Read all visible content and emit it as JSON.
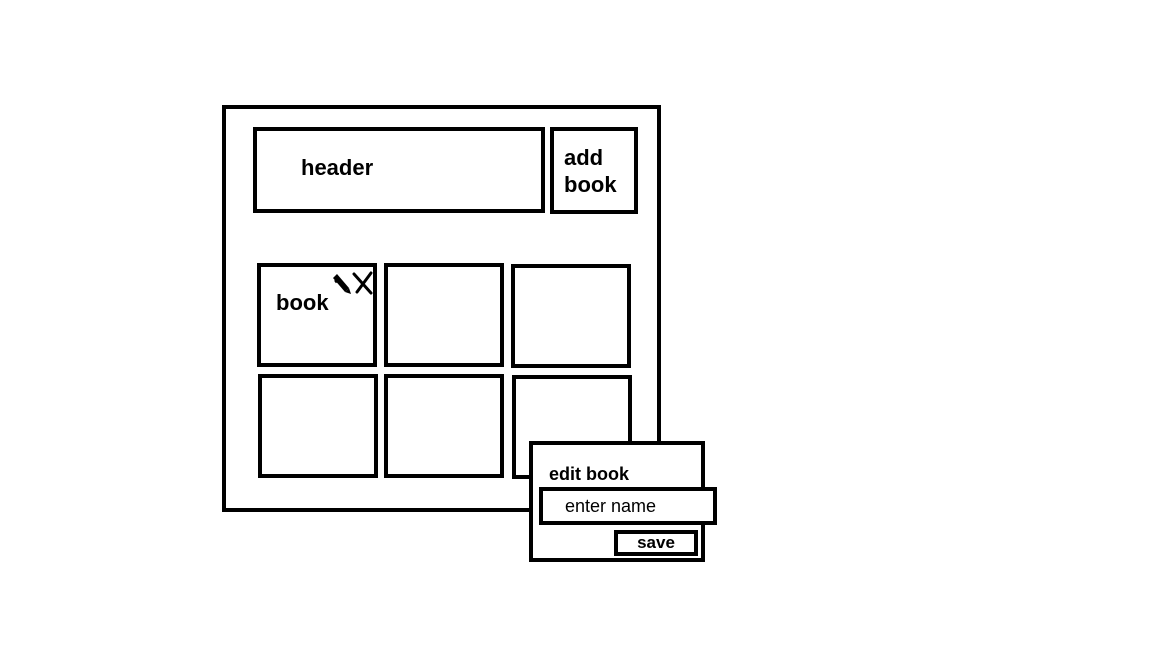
{
  "header": {
    "title": "header"
  },
  "toolbar": {
    "add_book_label": "add book"
  },
  "books": [
    {
      "label": "book",
      "has_actions": true
    },
    {
      "label": ""
    },
    {
      "label": ""
    },
    {
      "label": ""
    },
    {
      "label": ""
    },
    {
      "label": ""
    }
  ],
  "icons": {
    "edit": "pencil-icon",
    "delete": "x-icon"
  },
  "edit_dialog": {
    "title": "edit book",
    "name_placeholder": "enter name",
    "name_value": "",
    "save_label": "save"
  },
  "colors": {
    "stroke": "#000000",
    "background": "#ffffff"
  }
}
